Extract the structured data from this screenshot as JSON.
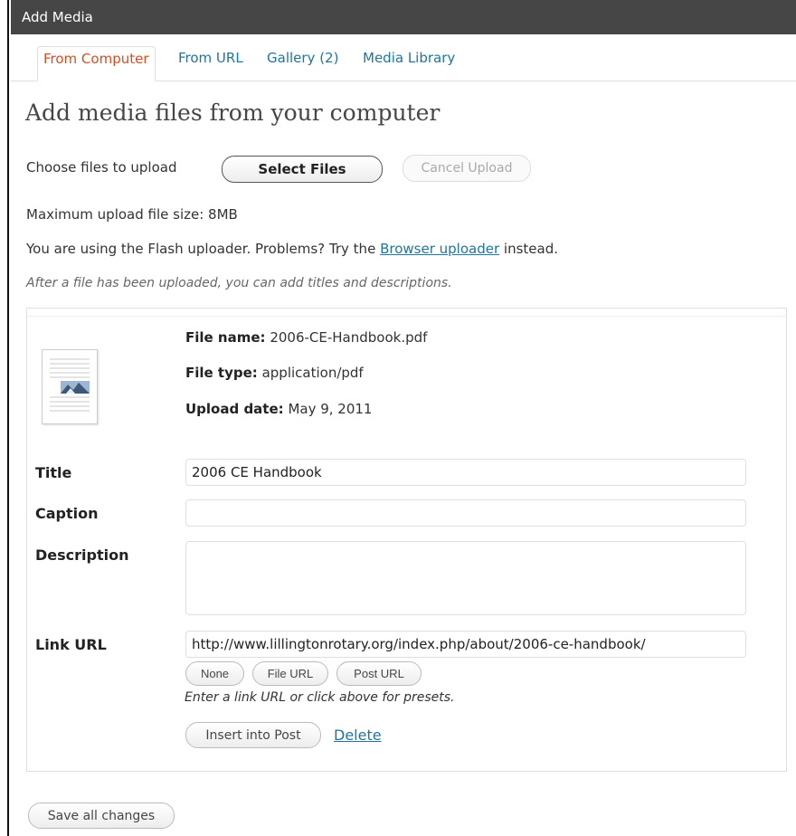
{
  "window": {
    "title": "Add Media"
  },
  "tabs": [
    {
      "label": "From Computer",
      "active": true
    },
    {
      "label": "From URL"
    },
    {
      "label": "Gallery (2)"
    },
    {
      "label": "Media Library"
    }
  ],
  "heading": "Add media files from your computer",
  "upload": {
    "choose_label": "Choose files to upload",
    "select_button": "Select Files",
    "cancel_button": "Cancel Upload",
    "max_size": "Maximum upload file size: 8MB",
    "flash_prefix": "You are using the Flash uploader.  Problems?  Try the",
    "browser_link": "Browser uploader",
    "flash_suffix": "instead.",
    "after_note": "After a file has been uploaded, you can add titles and descriptions."
  },
  "file": {
    "name_label": "File name:",
    "name_value": "2006-CE-Handbook.pdf",
    "type_label": "File type:",
    "type_value": "application/pdf",
    "date_label": "Upload date:",
    "date_value": "May 9, 2011"
  },
  "fields": {
    "title_label": "Title",
    "title_value": "2006 CE Handbook",
    "caption_label": "Caption",
    "caption_value": "",
    "description_label": "Description",
    "description_value": "",
    "link_label": "Link URL",
    "link_value": "http://www.lillingtonrotary.org/index.php/about/2006-ce-handbook/"
  },
  "link_buttons": {
    "none": "None",
    "file_url": "File URL",
    "post_url": "Post URL"
  },
  "link_help": "Enter a link URL or click above for presets.",
  "actions": {
    "insert": "Insert into Post",
    "delete": "Delete",
    "save_all": "Save all changes"
  },
  "colors": {
    "titlebar": "#464646",
    "link": "#21759b",
    "active_tab": "#d54e21"
  }
}
